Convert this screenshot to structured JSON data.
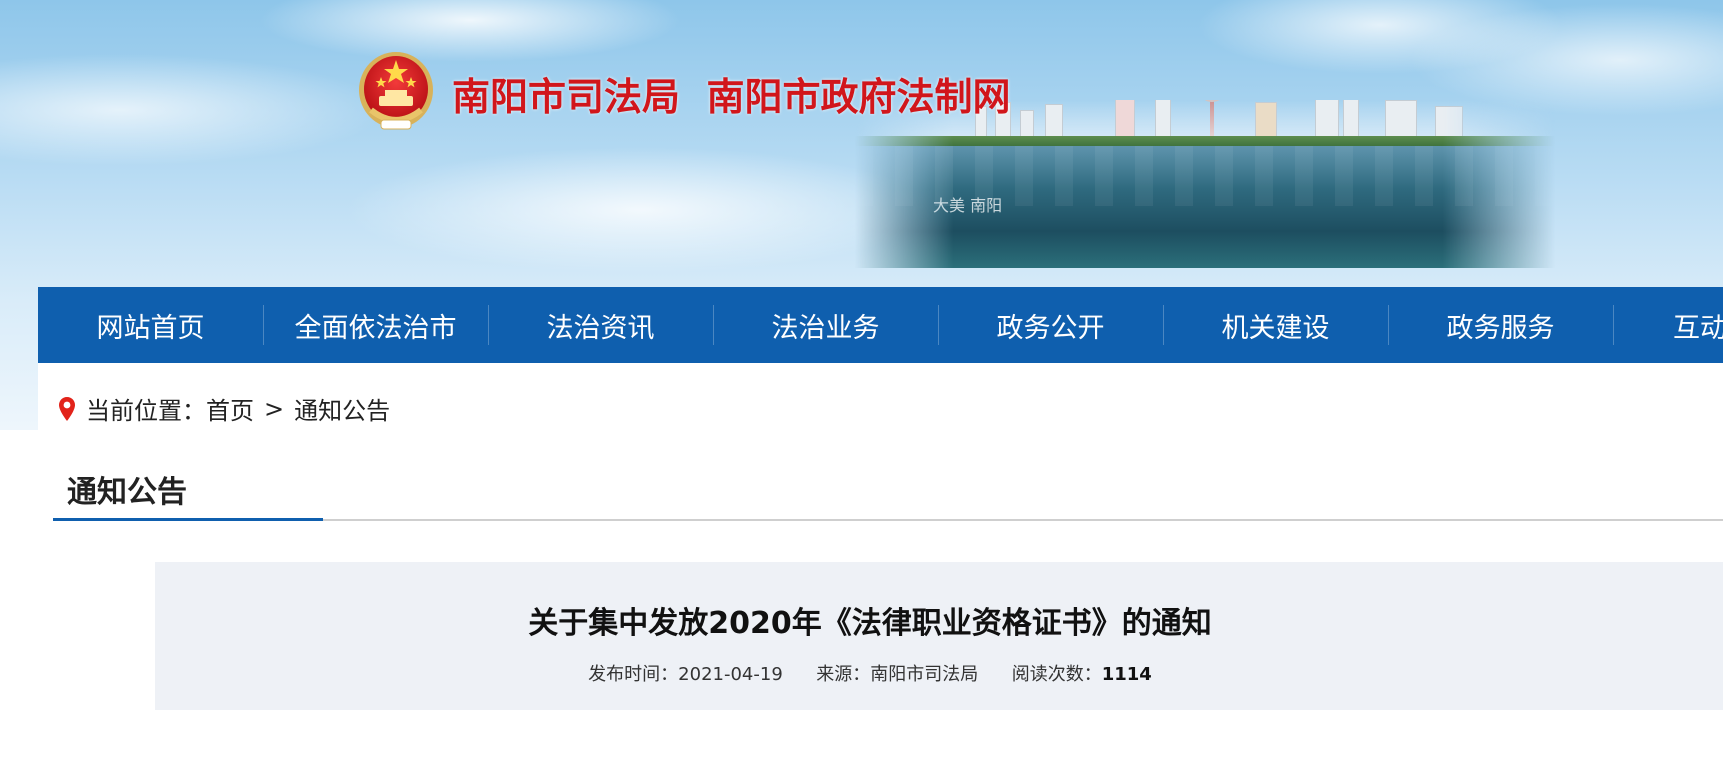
{
  "header": {
    "site_title": "南阳市司法局  南阳市政府法制网",
    "emblem_icon": "national-emblem-icon",
    "banner_text": "大美 南阳"
  },
  "nav": {
    "items": [
      {
        "label": "网站首页"
      },
      {
        "label": "全面依法治市"
      },
      {
        "label": "法治资讯"
      },
      {
        "label": "法治业务"
      },
      {
        "label": "政务公开"
      },
      {
        "label": "机关建设"
      },
      {
        "label": "政务服务"
      },
      {
        "label": "互动"
      }
    ]
  },
  "breadcrumb": {
    "icon": "location-pin-icon",
    "prefix": "当前位置：",
    "home": "首页",
    "separator": ">",
    "current": "通知公告"
  },
  "section": {
    "title": "通知公告"
  },
  "article": {
    "title": "关于集中发放2020年《法律职业资格证书》的通知",
    "date_label": "发布时间：",
    "date": "2021-04-19",
    "source_label": "来源：",
    "source": "南阳市司法局",
    "views_label": "阅读次数：",
    "views": "1114"
  },
  "colors": {
    "nav_bg": "#0f5fae",
    "title_red": "#d1161b",
    "article_bg": "#eef1f6",
    "accent": "#0f5fae"
  }
}
